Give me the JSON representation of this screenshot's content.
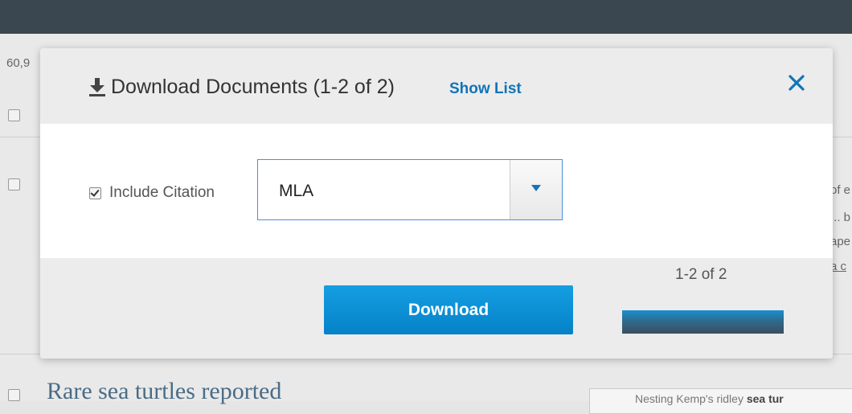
{
  "background": {
    "count_fragment": "60,9",
    "right_fragments": [
      "of e",
      "... b",
      "ape",
      "a c"
    ],
    "headline": "Rare sea turtles reported",
    "snippet_prefix": "Nesting Kemp's ridley ",
    "snippet_bold": "sea tur"
  },
  "modal": {
    "title": "Download Documents (1-2 of 2)",
    "show_list_label": "Show List",
    "close_icon": "close-icon",
    "download_icon": "download-icon",
    "include_citation_label": "Include Citation",
    "include_citation_checked": true,
    "citation_format": "MLA",
    "download_button_label": "Download",
    "range_label": "1-2 of 2",
    "progress_fraction": 1.0
  },
  "colors": {
    "accent": "#1174b8",
    "button": "#0a8fd6",
    "topbar": "#3a4650"
  }
}
